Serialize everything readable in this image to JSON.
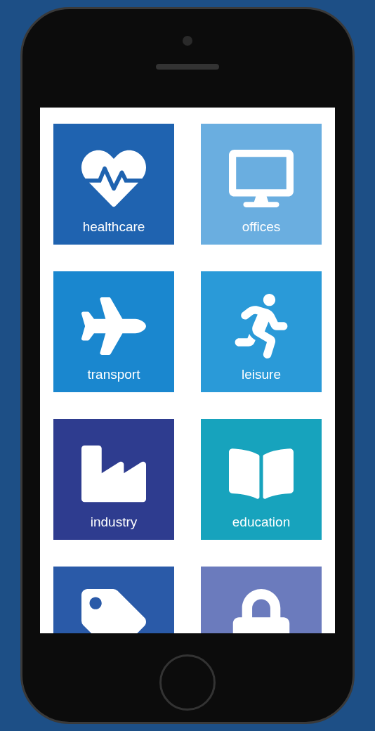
{
  "tiles": [
    {
      "label": "healthcare",
      "color": "#1f63b0"
    },
    {
      "label": "offices",
      "color": "#6aaee0"
    },
    {
      "label": "transport",
      "color": "#1a87cf"
    },
    {
      "label": "leisure",
      "color": "#2a9ad8"
    },
    {
      "label": "industry",
      "color": "#2e3c8f"
    },
    {
      "label": "education",
      "color": "#17a3bd"
    },
    {
      "color": "#2a5aa8"
    },
    {
      "color": "#6b7bbd"
    }
  ]
}
